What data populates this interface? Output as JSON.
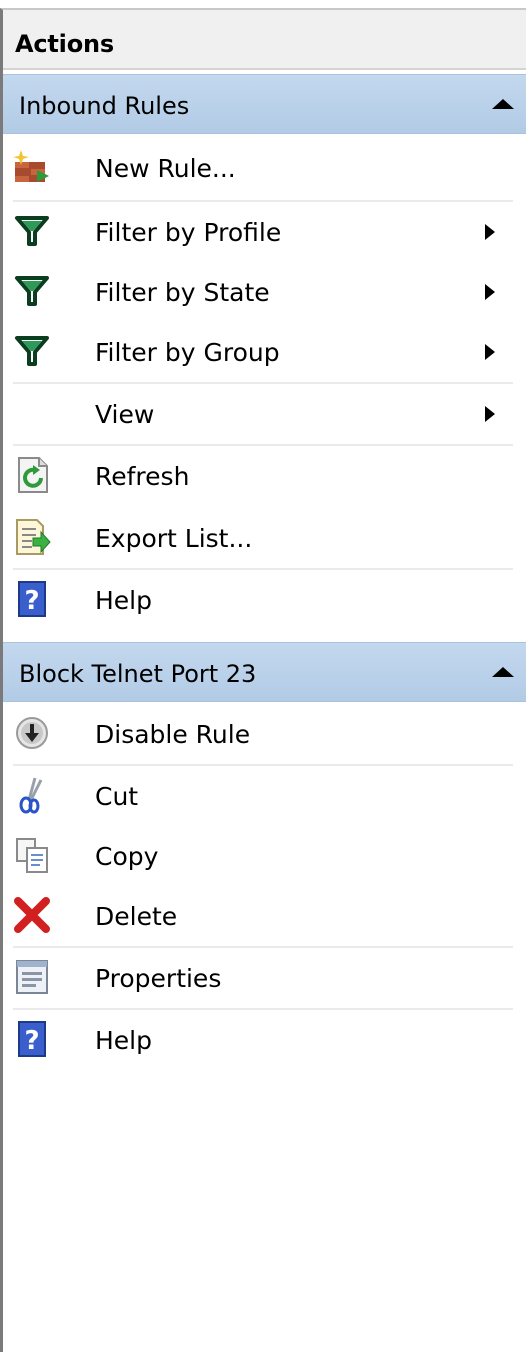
{
  "pane": {
    "title": "Actions"
  },
  "sections": [
    {
      "title": "Inbound Rules",
      "items": [
        {
          "label": "New Rule...",
          "icon": "new-rule-icon"
        },
        {
          "label": "Filter by Profile",
          "icon": "filter-icon",
          "submenu": true
        },
        {
          "label": "Filter by State",
          "icon": "filter-icon",
          "submenu": true
        },
        {
          "label": "Filter by Group",
          "icon": "filter-icon",
          "submenu": true
        },
        {
          "label": "View",
          "icon": "",
          "submenu": true
        },
        {
          "label": "Refresh",
          "icon": "refresh-icon"
        },
        {
          "label": "Export List...",
          "icon": "export-list-icon"
        },
        {
          "label": "Help",
          "icon": "help-icon"
        }
      ]
    },
    {
      "title": "Block Telnet Port 23",
      "items": [
        {
          "label": "Disable Rule",
          "icon": "disable-rule-icon"
        },
        {
          "label": "Cut",
          "icon": "cut-icon"
        },
        {
          "label": "Copy",
          "icon": "copy-icon"
        },
        {
          "label": "Delete",
          "icon": "delete-icon"
        },
        {
          "label": "Properties",
          "icon": "properties-icon"
        },
        {
          "label": "Help",
          "icon": "help-icon"
        }
      ]
    }
  ],
  "colors": {
    "section_header": "#b8d0ea",
    "filter_icon": "#1b6b3a",
    "help_icon": "#3a5fcd",
    "delete_icon": "#d21f1f",
    "refresh_icon": "#2e9a3a"
  }
}
